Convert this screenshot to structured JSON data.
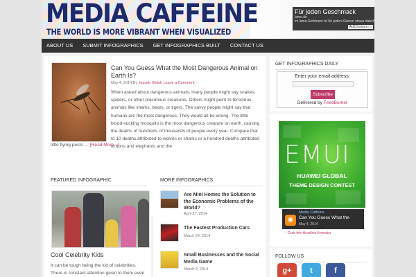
{
  "header": {
    "logo_title": "MEDIA CAFFEINE",
    "tagline": "THE WORLD IS MORE VIBRANT WHEN VISUALIZED",
    "ad": {
      "title": "Für jeden Geschmack",
      "line1": "lamo.de",
      "line2": "im lamo-Sortiment ist für jeden Kleinen etwas dabei!",
      "choices": "AdChoices ▷"
    }
  },
  "nav": {
    "items": [
      {
        "label": "ABOUT US"
      },
      {
        "label": "SUBMIT INFOGRAPHICS"
      },
      {
        "label": "GET INFOGRAPHICS BUILT"
      },
      {
        "label": "CONTACT US"
      }
    ]
  },
  "post": {
    "title": "Can You Guess What the Most Dangerous Animal on Earth Is?",
    "date": "May 4, 2014 By",
    "author": "Jesseb Shiloh",
    "comment": "Leave a Comment",
    "text_a": "When asked about dangerous animals, many people might say snakes, spiders, or other poisonous creatures. Others might point to ferocious animals like sharks, bears, or tigers. The savvy people might say that humans are the most dangerous. They would all be wrong. The little blood-sucking mosquito is the most dangerous creature on earth, causing the deaths of hundreds of thousands of people every year. Compare that to 10 deaths attributed to wolves or sharks or a hundred deaths attributed to lions and elephants and the",
    "text_b": "little flying pests …",
    "read_more": "[Read More...]"
  },
  "featured": {
    "heading": "FEATURED INFOGRAPHIC",
    "title": "Cool Celebrity Kids",
    "text": "It can be tough being the kid of celebrities. There is constant attention given to them even"
  },
  "more": {
    "heading": "MORE INFOGRAPHICS",
    "items": [
      {
        "title": "Are Mini Homes the Solution to the Economic Problems of the World?",
        "date": "April 27, 2014"
      },
      {
        "title": "The Fastest Production Cars",
        "date": "March 24, 2014"
      },
      {
        "title": "Small Businesses and the Social Media Game",
        "date": "March 9, 2014"
      }
    ]
  },
  "sidebar": {
    "daily_heading": "GET INFOGRAPHICS DAILY",
    "email_label": "Enter your email address:",
    "subscribe": "Subscribe",
    "delivered_by": "Delivered by",
    "feedburner": "FeedBurner",
    "emui": {
      "word": "EMUI",
      "line1": "HUAWEI GLOBAL",
      "line2": "THEME DESIGN CONTEST"
    },
    "rss": {
      "site": "Media Caffeine",
      "headline": "Can You Guess What the",
      "date": "May 4, 2014",
      "grab": "↑ Grab this Headline Animator"
    },
    "follow_heading": "FOLLOW US",
    "social": [
      {
        "glyph": "g+",
        "color": "#d34836"
      },
      {
        "glyph": "t",
        "color": "#3fa9e0"
      },
      {
        "glyph": "f",
        "color": "#3b5998"
      }
    ]
  },
  "colors": {
    "accent": "#c0396b",
    "nav": "#333333",
    "logo": "#1d2a6b"
  }
}
